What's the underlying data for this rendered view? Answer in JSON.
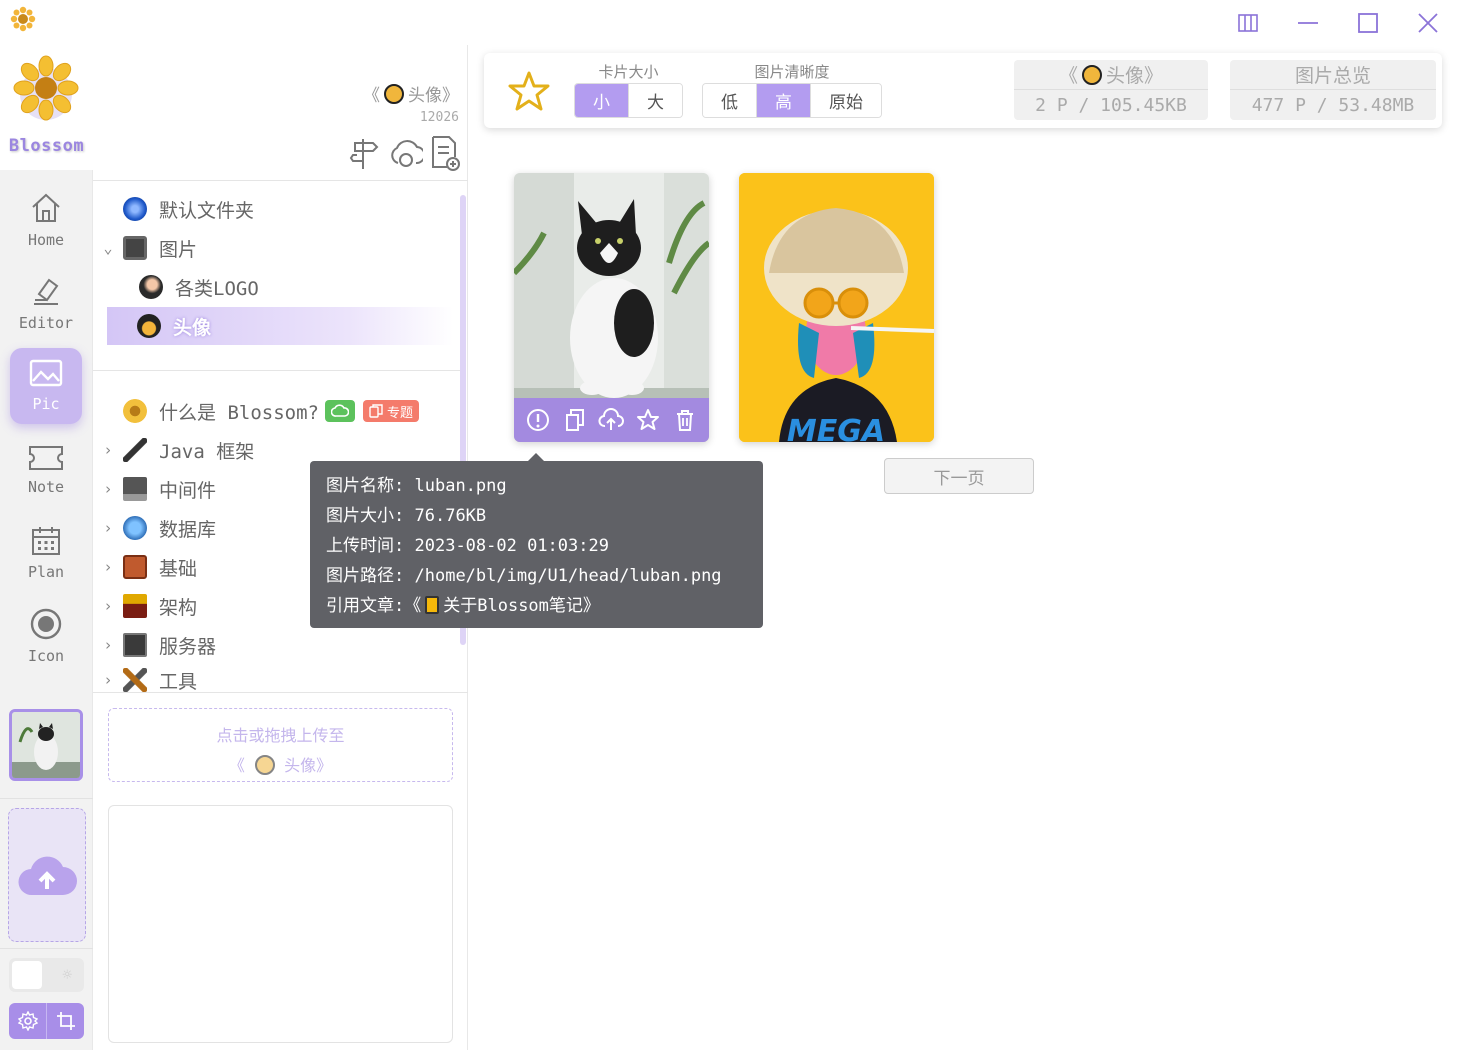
{
  "app": {
    "brand_name": "Blossom",
    "accent": "#b39cf0"
  },
  "window_controls": [
    "columns-icon",
    "minimize-icon",
    "maximize-icon",
    "close-icon"
  ],
  "nav": [
    {
      "label": "Home",
      "icon": "home-icon",
      "active": false
    },
    {
      "label": "Editor",
      "icon": "editor-icon",
      "active": false
    },
    {
      "label": "Pic",
      "icon": "picture-icon",
      "active": true
    },
    {
      "label": "Note",
      "icon": "ticket-icon",
      "active": false
    },
    {
      "label": "Plan",
      "icon": "calendar-icon",
      "active": false
    },
    {
      "label": "Icon",
      "icon": "record-icon",
      "active": false
    }
  ],
  "folder_header": {
    "title_prefix": "《",
    "title": "头像》",
    "count": "12026"
  },
  "tree": {
    "pic_folders": [
      {
        "label": "默认文件夹",
        "icon": "blue-orb-icon",
        "chevron": ""
      },
      {
        "label": "图片",
        "icon": "camera-icon",
        "chevron": "⌄"
      },
      {
        "label": "各类LOGO",
        "icon": "avatar-icon",
        "chevron": ""
      },
      {
        "label": "头像",
        "icon": "boy-avatar-icon",
        "chevron": "",
        "selected": true
      }
    ],
    "doc_folders": [
      {
        "label": "什么是 Blossom?",
        "icon": "flower-icon",
        "chevron": "",
        "tag": "专题"
      },
      {
        "label": "Java 框架",
        "icon": "feather-icon",
        "chevron": "›"
      },
      {
        "label": "中间件",
        "icon": "laptop-icon",
        "chevron": "›"
      },
      {
        "label": "数据库",
        "icon": "database-icon",
        "chevron": "›"
      },
      {
        "label": "基础",
        "icon": "brick-icon",
        "chevron": "›"
      },
      {
        "label": "架构",
        "icon": "crane-icon",
        "chevron": "›"
      },
      {
        "label": "服务器",
        "icon": "monitor-icon",
        "chevron": "›"
      },
      {
        "label": "工具",
        "icon": "tools-icon",
        "chevron": "›"
      }
    ]
  },
  "upload_box": {
    "line1": "点击或拖拽上传至",
    "line2_prefix": "《",
    "line2": "头像》"
  },
  "toolbar": {
    "card_size_label": "卡片大小",
    "card_size_options": [
      "小",
      "大"
    ],
    "card_size_selected": "小",
    "clarity_label": "图片清晰度",
    "clarity_options": [
      "低",
      "高",
      "原始"
    ],
    "clarity_selected": "高",
    "folder_stat_title_prefix": "《",
    "folder_stat_title": "头像》",
    "folder_stat_value": "2 P / 105.45KB",
    "total_stat_title": "图片总览",
    "total_stat_value": "477 P / 53.48MB"
  },
  "cards": [
    {
      "name": "cat-photo",
      "actions": [
        "info-icon",
        "copy-icon",
        "cloud-icon",
        "star-icon",
        "delete-icon"
      ]
    },
    {
      "name": "mega-illustration",
      "caption": "MEGA"
    }
  ],
  "next_page": "下一页",
  "tooltip": {
    "name_label": "图片名称:",
    "name_value": "luban.png",
    "size_label": "图片大小:",
    "size_value": "76.76KB",
    "time_label": "上传时间:",
    "time_value": "2023-08-02 01:03:29",
    "path_label": "图片路径:",
    "path_value": "/home/bl/img/U1/head/luban.png",
    "ref_label": "引用文章:",
    "ref_prefix": "《",
    "ref_value": "关于Blossom笔记》"
  }
}
